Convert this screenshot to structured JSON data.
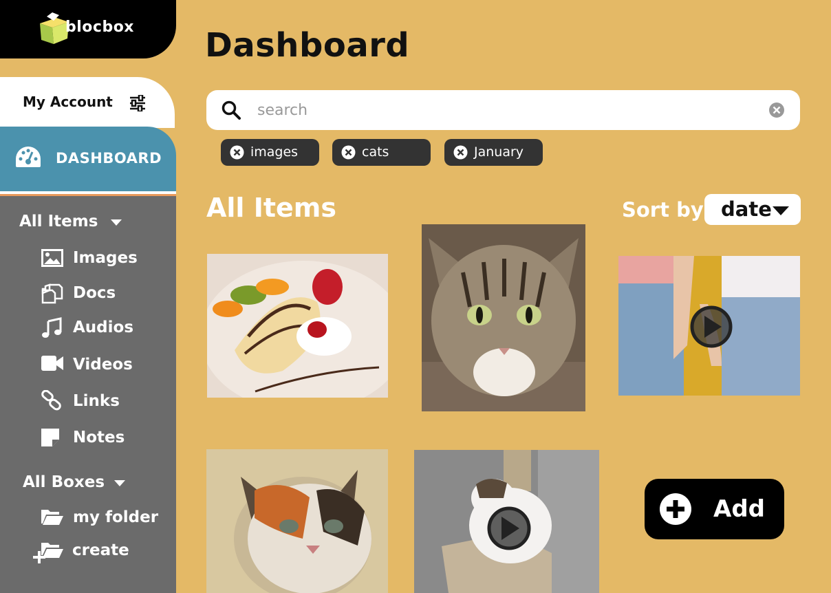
{
  "app": {
    "name": "blocbox"
  },
  "sidebar": {
    "account_label": "My Account",
    "dashboard_label": "DASHBOARD",
    "all_items_label": "All Items",
    "items": [
      {
        "label": "Images",
        "icon": "image-icon"
      },
      {
        "label": "Docs",
        "icon": "docs-icon"
      },
      {
        "label": "Audios",
        "icon": "music-note-icon"
      },
      {
        "label": "Videos",
        "icon": "video-camera-icon"
      },
      {
        "label": "Links",
        "icon": "link-icon"
      },
      {
        "label": "Notes",
        "icon": "note-icon"
      }
    ],
    "all_boxes_label": "All Boxes",
    "boxes": [
      {
        "label": "my folder",
        "icon": "folder-open-icon"
      },
      {
        "label": "create",
        "icon": "folder-add-icon"
      }
    ]
  },
  "main": {
    "title": "Dashboard",
    "search": {
      "placeholder": "search",
      "value": ""
    },
    "filters": [
      "images",
      "cats",
      "January"
    ],
    "section_title": "All Items",
    "sort": {
      "label": "Sort by",
      "value": "date"
    },
    "add_label": "Add"
  },
  "colors": {
    "background": "#e4b966",
    "logo_bar": "#000000",
    "dashboard_active": "#4b92ad",
    "nav_bg": "#6b6b6b",
    "chip_bg": "#333333"
  }
}
